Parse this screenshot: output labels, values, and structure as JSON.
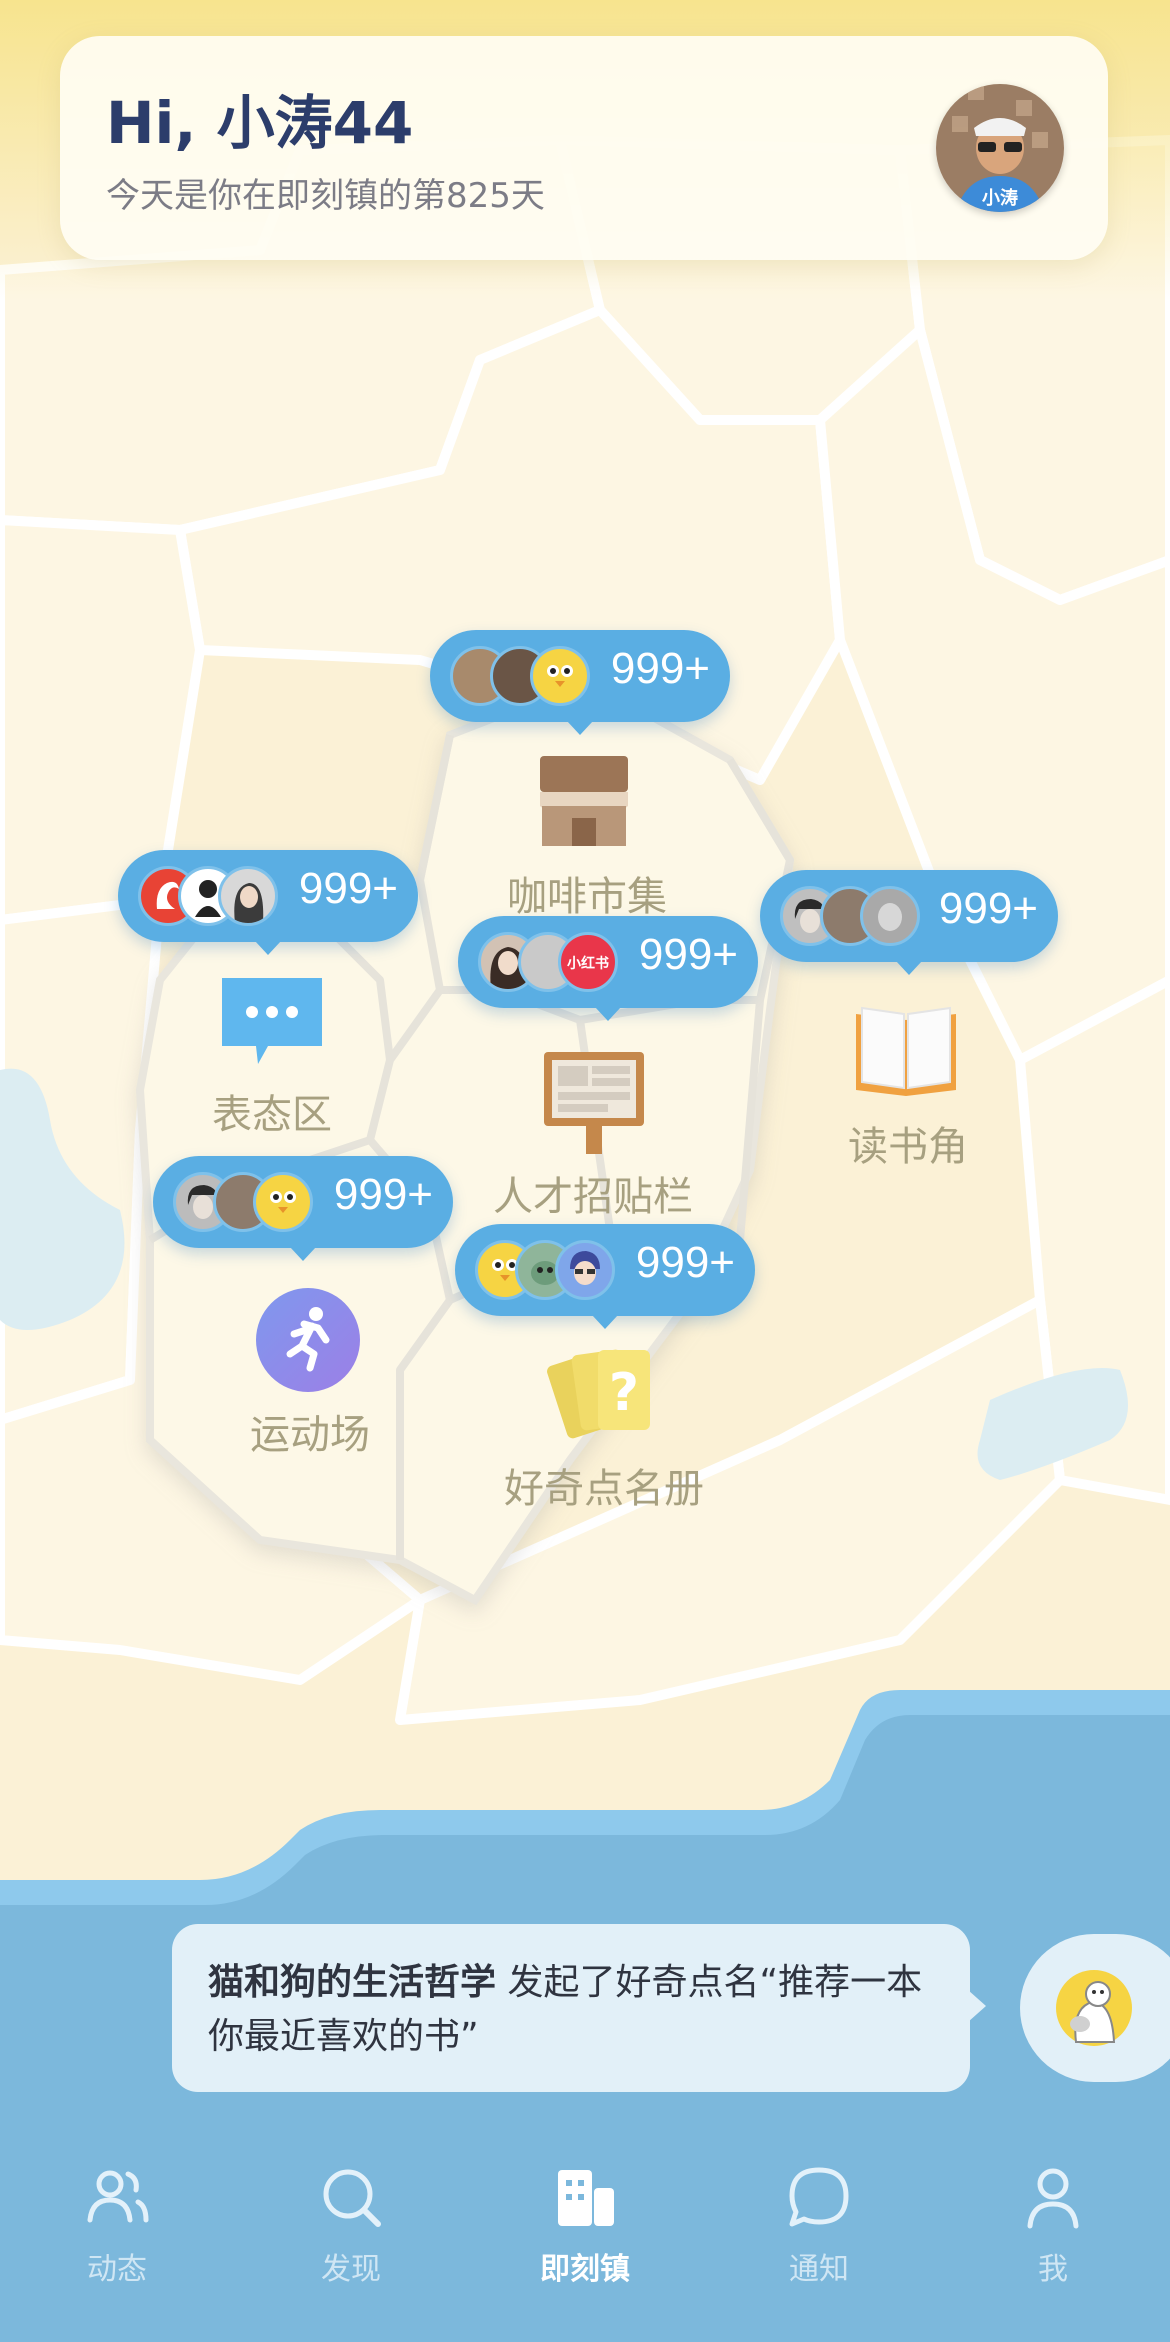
{
  "header": {
    "greeting": "Hi, 小涛44",
    "days_text": "今天是你在即刻镇的第825天"
  },
  "places": [
    {
      "name": "咖啡市集",
      "count": "999+"
    },
    {
      "name": "表态区",
      "count": "999+"
    },
    {
      "name": "人才招贴栏",
      "count": "999+",
      "badge": "小红书"
    },
    {
      "name": "读书角",
      "count": "999+"
    },
    {
      "name": "运动场",
      "count": "999+"
    },
    {
      "name": "好奇点名册",
      "count": "999+"
    }
  ],
  "notice": {
    "user": "猫和狗的生活哲学",
    "text": " 发起了好奇点名“推荐一本你最近喜欢的书”"
  },
  "tabs": [
    {
      "label": "动态",
      "icon": "users-icon"
    },
    {
      "label": "发现",
      "icon": "search-icon"
    },
    {
      "label": "即刻镇",
      "icon": "town-buildings-icon",
      "active": true
    },
    {
      "label": "通知",
      "icon": "chat-bubble-icon"
    },
    {
      "label": "我",
      "icon": "person-icon"
    }
  ],
  "colors": {
    "accent": "#5aaee3",
    "sea": "#7cb8dc",
    "header_title": "#2c3d6b",
    "map_base": "#fdf6e3"
  }
}
